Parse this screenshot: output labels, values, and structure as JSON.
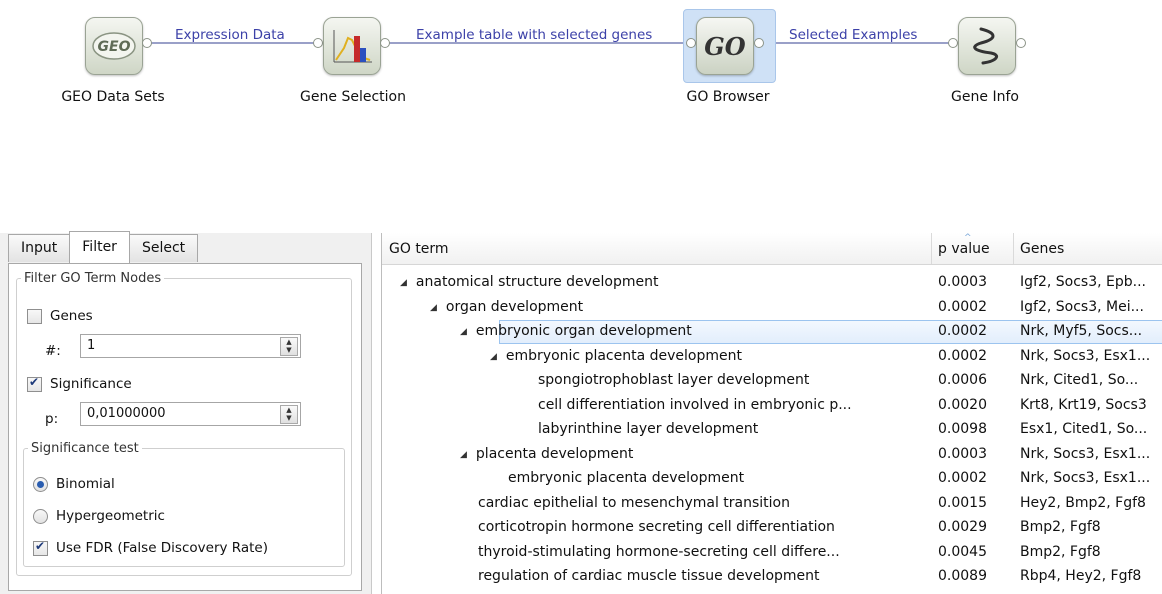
{
  "workflow": {
    "widgets": [
      {
        "label": "GEO Data Sets",
        "icon": "geo-icon",
        "icon_text": "GEO"
      },
      {
        "label": "Gene Selection",
        "icon": "histogram-icon"
      },
      {
        "label": "GO Browser",
        "icon": "go-icon",
        "icon_text": "GO"
      },
      {
        "label": "Gene Info",
        "icon": "dna-icon"
      }
    ],
    "links": [
      "Expression Data",
      "Example table with selected genes",
      "Selected Examples"
    ]
  },
  "left_panel": {
    "tabs": [
      "Input",
      "Filter",
      "Select"
    ],
    "active_tab": "Filter",
    "filter_group_title": "Filter GO Term Nodes",
    "genes": {
      "label": "Genes",
      "checked": false,
      "count_label": "#:",
      "count_value": "1"
    },
    "significance": {
      "label": "Significance",
      "checked": true,
      "p_label": "p:",
      "p_value": "0,01000000"
    },
    "test_group_title": "Significance test",
    "tests": [
      {
        "label": "Binomial",
        "selected": true
      },
      {
        "label": "Hypergeometric",
        "selected": false
      }
    ],
    "fdr": {
      "label": "Use FDR (False Discovery Rate)",
      "checked": true
    }
  },
  "table": {
    "headers": [
      "GO term",
      "p value",
      "Genes"
    ],
    "rows": [
      {
        "term": "anatomical structure development",
        "p": "0.0003",
        "genes": "Igf2, Socs3, Epb...",
        "level": 0,
        "expanded": true
      },
      {
        "term": "organ development",
        "p": "0.0002",
        "genes": "Igf2, Socs3, Mei...",
        "level": 1,
        "expanded": true
      },
      {
        "term": "embryonic organ development",
        "p": "0.0002",
        "genes": "Nrk, Myf5, Socs...",
        "level": 2,
        "expanded": true,
        "selected": true
      },
      {
        "term": "embryonic placenta development",
        "p": "0.0002",
        "genes": "Nrk, Socs3, Esx1...",
        "level": 3,
        "expanded": true
      },
      {
        "term": "spongiotrophoblast layer development",
        "p": "0.0006",
        "genes": "Nrk, Cited1, So...",
        "level": 4
      },
      {
        "term": "cell differentiation involved in embryonic p...",
        "p": "0.0020",
        "genes": "Krt8, Krt19, Socs3",
        "level": 4
      },
      {
        "term": "labyrinthine layer development",
        "p": "0.0098",
        "genes": "Esx1, Cited1, So...",
        "level": 4
      },
      {
        "term": "placenta development",
        "p": "0.0003",
        "genes": "Nrk, Socs3, Esx1...",
        "level": 2,
        "expanded": true
      },
      {
        "term": "embryonic placenta development",
        "p": "0.0002",
        "genes": "Nrk, Socs3, Esx1...",
        "level": 3
      },
      {
        "term": "cardiac epithelial to mesenchymal transition",
        "p": "0.0015",
        "genes": "Hey2, Bmp2, Fgf8",
        "level": 2
      },
      {
        "term": "corticotropin hormone secreting cell differentiation",
        "p": "0.0029",
        "genes": "Bmp2, Fgf8",
        "level": 2
      },
      {
        "term": "thyroid-stimulating hormone-secreting cell differe...",
        "p": "0.0045",
        "genes": "Bmp2, Fgf8",
        "level": 2
      },
      {
        "term": "regulation of cardiac muscle tissue development",
        "p": "0.0089",
        "genes": "Rbp4, Hey2, Fgf8",
        "level": 2
      }
    ]
  },
  "colors": {
    "link_label": "#3c41a8",
    "selection": "#cfe1f6"
  }
}
